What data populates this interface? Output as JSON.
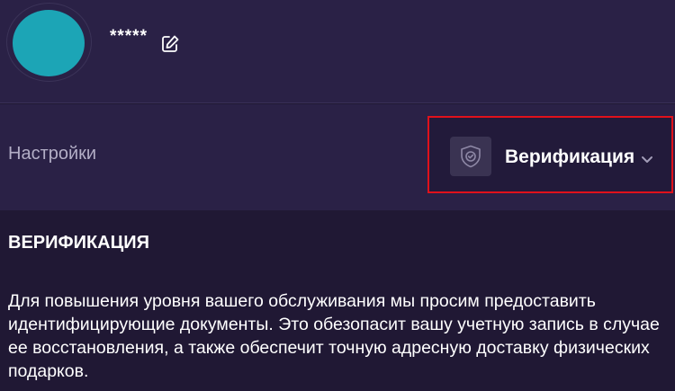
{
  "profile": {
    "username": "*****",
    "avatar_color": "#1ca5b6"
  },
  "settings": {
    "label": "Настройки",
    "dropdown": {
      "selected": "Верификация",
      "icon": "shield-check-icon",
      "highlight_color": "#e0111b"
    }
  },
  "verification": {
    "title": "ВЕРИФИКАЦИЯ",
    "description": "Для повышения уровня вашего обслуживания мы просим предоставить идентифицирующие документы. Это обезопасит вашу учетную запись в случае ее восстановления, а также обеспечит точную адресную доставку физических подарков."
  }
}
